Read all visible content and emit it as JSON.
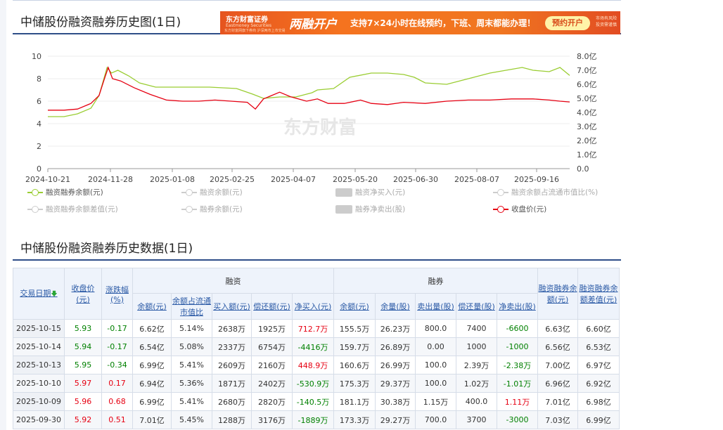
{
  "chart_title": "中储股份融资融券历史图(1日)",
  "table_title": "中储股份融资融券历史数据(1日)",
  "banner": {
    "brand": "东方财富证券",
    "brand_sub": "Eastmoney Securities",
    "tagline": "东方财富网旗下券商 沪深两市上市交易",
    "headline": "两融开户",
    "subtext": "支持7×24小时在线预约，下班、周末都能办理！",
    "button": "预约开户",
    "note": "市场有风险 投资需谨慎"
  },
  "watermark": "东方财富",
  "legend": [
    {
      "label": "融资融券余额(元)",
      "style": "green",
      "active": true
    },
    {
      "label": "融资余额(元)",
      "style": "grey",
      "active": false
    },
    {
      "label": "融资净买入(元)",
      "style": "box",
      "active": false
    },
    {
      "label": "融资余额占流通市值比(%)",
      "style": "grey",
      "active": false
    },
    {
      "label": "融资融券余额差值(元)",
      "style": "grey",
      "active": false
    },
    {
      "label": "融券余额(元)",
      "style": "grey",
      "active": false
    },
    {
      "label": "融券净卖出(股)",
      "style": "box",
      "active": false
    },
    {
      "label": "收盘价(元)",
      "style": "red",
      "active": true
    }
  ],
  "chart_data": {
    "type": "line",
    "x_ticks": [
      "2024-10-21",
      "2024-11-28",
      "2025-01-08",
      "2025-02-25",
      "2025-04-07",
      "2025-05-20",
      "2025-06-30",
      "2025-08-07",
      "2025-09-16"
    ],
    "y_left": {
      "min": 0,
      "max": 10,
      "ticks": [
        "0",
        "2",
        "4",
        "6",
        "8",
        "10"
      ]
    },
    "y_right": {
      "min": 0,
      "max": 8,
      "ticks": [
        "0.0",
        "1.0亿",
        "2.0亿",
        "3.0亿",
        "4.0亿",
        "5.0亿",
        "6.0亿",
        "7.0亿",
        "8.0亿"
      ]
    },
    "series": [
      {
        "name": "融资融券余额(元)",
        "axis": "right",
        "color": "#9acd32",
        "points": [
          [
            0,
            3.7
          ],
          [
            0.3,
            3.7
          ],
          [
            0.55,
            3.9
          ],
          [
            0.8,
            4.3
          ],
          [
            0.95,
            5.2
          ],
          [
            1.1,
            7.2
          ],
          [
            1.18,
            6.8
          ],
          [
            1.3,
            7.0
          ],
          [
            1.5,
            6.6
          ],
          [
            1.7,
            6.1
          ],
          [
            2.0,
            5.8
          ],
          [
            2.5,
            5.8
          ],
          [
            3.0,
            5.8
          ],
          [
            3.5,
            5.7
          ],
          [
            3.8,
            5.3
          ],
          [
            4.0,
            5.0
          ],
          [
            4.3,
            5.1
          ],
          [
            4.6,
            5.1
          ],
          [
            4.9,
            5.4
          ],
          [
            5.0,
            5.6
          ],
          [
            5.3,
            5.7
          ],
          [
            5.6,
            6.5
          ],
          [
            6.0,
            6.8
          ],
          [
            6.3,
            6.8
          ],
          [
            6.6,
            6.7
          ],
          [
            6.8,
            6.5
          ],
          [
            7.0,
            6.1
          ],
          [
            7.4,
            6.0
          ],
          [
            7.8,
            6.4
          ],
          [
            8.2,
            6.8
          ],
          [
            8.5,
            7.0
          ],
          [
            8.8,
            7.2
          ],
          [
            9.0,
            7.0
          ],
          [
            9.3,
            6.9
          ],
          [
            9.5,
            7.2
          ],
          [
            9.68,
            6.63
          ]
        ]
      },
      {
        "name": "收盘价(元)",
        "axis": "left",
        "color": "#e60012",
        "points": [
          [
            0,
            5.2
          ],
          [
            0.3,
            5.2
          ],
          [
            0.55,
            5.3
          ],
          [
            0.8,
            5.8
          ],
          [
            0.95,
            6.5
          ],
          [
            1.05,
            8.0
          ],
          [
            1.12,
            9.0
          ],
          [
            1.2,
            8.0
          ],
          [
            1.35,
            7.8
          ],
          [
            1.6,
            7.2
          ],
          [
            1.9,
            6.6
          ],
          [
            2.2,
            6.1
          ],
          [
            2.5,
            6.0
          ],
          [
            2.8,
            6.0
          ],
          [
            3.1,
            6.1
          ],
          [
            3.4,
            6.0
          ],
          [
            3.7,
            5.9
          ],
          [
            3.85,
            5.3
          ],
          [
            4.0,
            6.2
          ],
          [
            4.15,
            6.5
          ],
          [
            4.3,
            6.8
          ],
          [
            4.5,
            6.4
          ],
          [
            4.8,
            6.0
          ],
          [
            5.0,
            6.2
          ],
          [
            5.2,
            5.8
          ],
          [
            5.5,
            5.8
          ],
          [
            5.8,
            6.1
          ],
          [
            6.0,
            5.8
          ],
          [
            6.3,
            5.7
          ],
          [
            6.6,
            5.9
          ],
          [
            7.0,
            5.8
          ],
          [
            7.4,
            6.0
          ],
          [
            7.8,
            6.1
          ],
          [
            8.2,
            6.1
          ],
          [
            8.6,
            6.2
          ],
          [
            9.0,
            6.2
          ],
          [
            9.3,
            6.1
          ],
          [
            9.5,
            6.0
          ],
          [
            9.68,
            5.93
          ]
        ]
      }
    ]
  },
  "table": {
    "headers": {
      "date": "交易日期",
      "close": "收盘价(元)",
      "change": "涨跌幅(%)",
      "rz_group": "融资",
      "rq_group": "融券",
      "rz_balance": "余额(元)",
      "rz_ratio": "余额占流通市值比",
      "rz_buy": "买入额(元)",
      "rz_repay": "偿还额(元)",
      "rz_net": "净买入(元)",
      "rq_balance": "余额(元)",
      "rq_volume": "余量(股)",
      "rq_sell": "卖出量(股)",
      "rq_repay": "偿还量(股)",
      "rq_net": "净卖出(股)",
      "total": "融资融券余额(元)",
      "diff": "融资融券余额差值(元)"
    },
    "rows": [
      {
        "date": "2025-10-15",
        "close": "5.93",
        "change": "-0.17",
        "rz_balance": "6.62亿",
        "rz_ratio": "5.14%",
        "rz_buy": "2638万",
        "rz_repay": "1925万",
        "rz_net": "712.7万",
        "rq_balance": "155.5万",
        "rq_volume": "26.23万",
        "rq_sell": "800.0",
        "rq_repay": "7400",
        "rq_net": "-6600",
        "total": "6.63亿",
        "diff": "6.60亿",
        "dir": "down"
      },
      {
        "date": "2025-10-14",
        "close": "5.94",
        "change": "-0.17",
        "rz_balance": "6.54亿",
        "rz_ratio": "5.08%",
        "rz_buy": "2337万",
        "rz_repay": "6754万",
        "rz_net": "-4416万",
        "rq_balance": "159.7万",
        "rq_volume": "26.89万",
        "rq_sell": "0.00",
        "rq_repay": "1000",
        "rq_net": "-1000",
        "total": "6.56亿",
        "diff": "6.53亿",
        "dir": "down"
      },
      {
        "date": "2025-10-13",
        "close": "5.95",
        "change": "-0.34",
        "rz_balance": "6.99亿",
        "rz_ratio": "5.41%",
        "rz_buy": "2609万",
        "rz_repay": "2160万",
        "rz_net": "448.9万",
        "rq_balance": "160.6万",
        "rq_volume": "26.99万",
        "rq_sell": "100.0",
        "rq_repay": "2.39万",
        "rq_net": "-2.38万",
        "total": "7.00亿",
        "diff": "6.97亿",
        "dir": "down"
      },
      {
        "date": "2025-10-10",
        "close": "5.97",
        "change": "0.17",
        "rz_balance": "6.94亿",
        "rz_ratio": "5.36%",
        "rz_buy": "1871万",
        "rz_repay": "2402万",
        "rz_net": "-530.9万",
        "rq_balance": "175.3万",
        "rq_volume": "29.37万",
        "rq_sell": "100.0",
        "rq_repay": "1.02万",
        "rq_net": "-1.01万",
        "total": "6.96亿",
        "diff": "6.92亿",
        "dir": "up"
      },
      {
        "date": "2025-10-09",
        "close": "5.96",
        "change": "0.68",
        "rz_balance": "6.99亿",
        "rz_ratio": "5.41%",
        "rz_buy": "2680万",
        "rz_repay": "2820万",
        "rz_net": "-140.5万",
        "rq_balance": "181.1万",
        "rq_volume": "30.38万",
        "rq_sell": "1.15万",
        "rq_repay": "400.0",
        "rq_net": "1.11万",
        "total": "7.01亿",
        "diff": "6.98亿",
        "dir": "up"
      },
      {
        "date": "2025-09-30",
        "close": "5.92",
        "change": "0.51",
        "rz_balance": "7.01亿",
        "rz_ratio": "5.45%",
        "rz_buy": "1288万",
        "rz_repay": "3176万",
        "rz_net": "-1889万",
        "rq_balance": "173.3万",
        "rq_volume": "29.27万",
        "rq_sell": "700.0",
        "rq_repay": "3700",
        "rq_net": "-3000",
        "total": "7.03亿",
        "diff": "6.99亿",
        "dir": "up"
      }
    ]
  }
}
